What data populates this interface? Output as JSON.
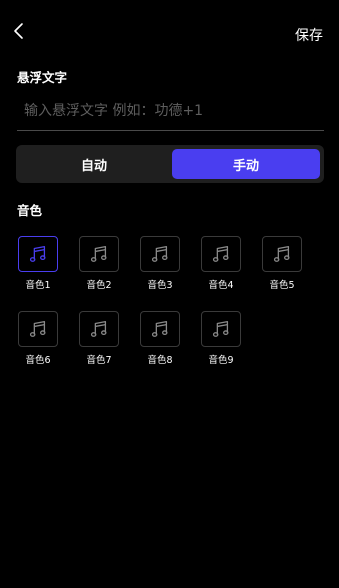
{
  "header": {
    "back_icon": "chevron-left-icon",
    "save_label": "保存"
  },
  "float_text": {
    "label": "悬浮文字",
    "placeholder": "输入悬浮文字 例如：功德+1",
    "value": ""
  },
  "mode": {
    "options": [
      "自动",
      "手动"
    ],
    "selected": "手动"
  },
  "tones": {
    "label": "音色",
    "selected": "音色1",
    "items": [
      "音色1",
      "音色2",
      "音色3",
      "音色4",
      "音色5",
      "音色6",
      "音色7",
      "音色8",
      "音色9"
    ],
    "icon": "music-note-icon"
  },
  "colors": {
    "background": "#000000",
    "accent": "#4a3ef0",
    "segment_bg": "#1f1f1f",
    "icon_idle": "#8a8a8a",
    "border_idle": "#3a3a3a"
  }
}
